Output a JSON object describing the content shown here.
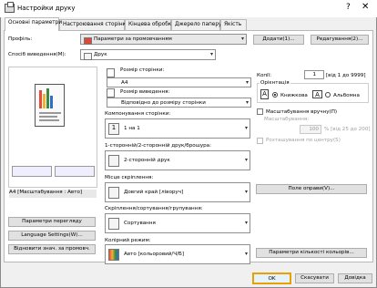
{
  "window": {
    "title": "Настройки друку",
    "help": "?",
    "close": "✕"
  },
  "tabs": [
    {
      "label": "Основні параметри"
    },
    {
      "label": "Настроювання сторінки"
    },
    {
      "label": "Кінцева обробка"
    },
    {
      "label": "Джерело паперу"
    },
    {
      "label": "Якість"
    }
  ],
  "profile": {
    "label": "Профіль:",
    "value": "Параметри за промовчанням",
    "add": "Додати(1)...",
    "edit": "Редагування(2)..."
  },
  "output": {
    "label": "Спосіб виведення(M):",
    "value": "Друк"
  },
  "preview": {
    "caption": "A4 [Масштабування : Авто]"
  },
  "left_buttons": {
    "preview": "Параметри перегляду",
    "language": "Language Settings(W)...",
    "restore": "Відновити знач. за промовч."
  },
  "page_size": {
    "label": "Розмір сторінки:",
    "value": "A4"
  },
  "output_size": {
    "label": "Розмір виведення:",
    "value": "Відповідно до розміру сторінки"
  },
  "layout": {
    "label": "Компонування сторінки:",
    "value": "1 на 1",
    "num": "1"
  },
  "duplex": {
    "label": "1-сторонній/2-сторонній друк/брошура:",
    "value": "2-сторонній друк"
  },
  "binding": {
    "label": "Місце скріплення:",
    "value": "Довгий край [ліворуч]"
  },
  "binding_btn": "Поле оправи(V)...",
  "finishing": {
    "label": "Скріплення/сортування/групування:",
    "value": "Сортування"
  },
  "color": {
    "label": "Колірний режим:",
    "value": "Авто [кольоровий/Ч/Б]"
  },
  "color_btn": "Параметри кількості кольорів...",
  "copies": {
    "label": "Копії:",
    "value": "1",
    "range": "[від 1 до 9999]"
  },
  "orientation": {
    "label": "Орієнтація",
    "portrait": "Книжкова",
    "landscape": "Альбомна"
  },
  "scaling": {
    "manual": "Масштабування вручну(П)",
    "label": "Масштабування:",
    "value": "100",
    "range": "% [від 25 до 200]",
    "center": "Розташування по центру(5)"
  },
  "footer": {
    "ok": "OK",
    "cancel": "Скасувати",
    "help": "Довідка"
  }
}
